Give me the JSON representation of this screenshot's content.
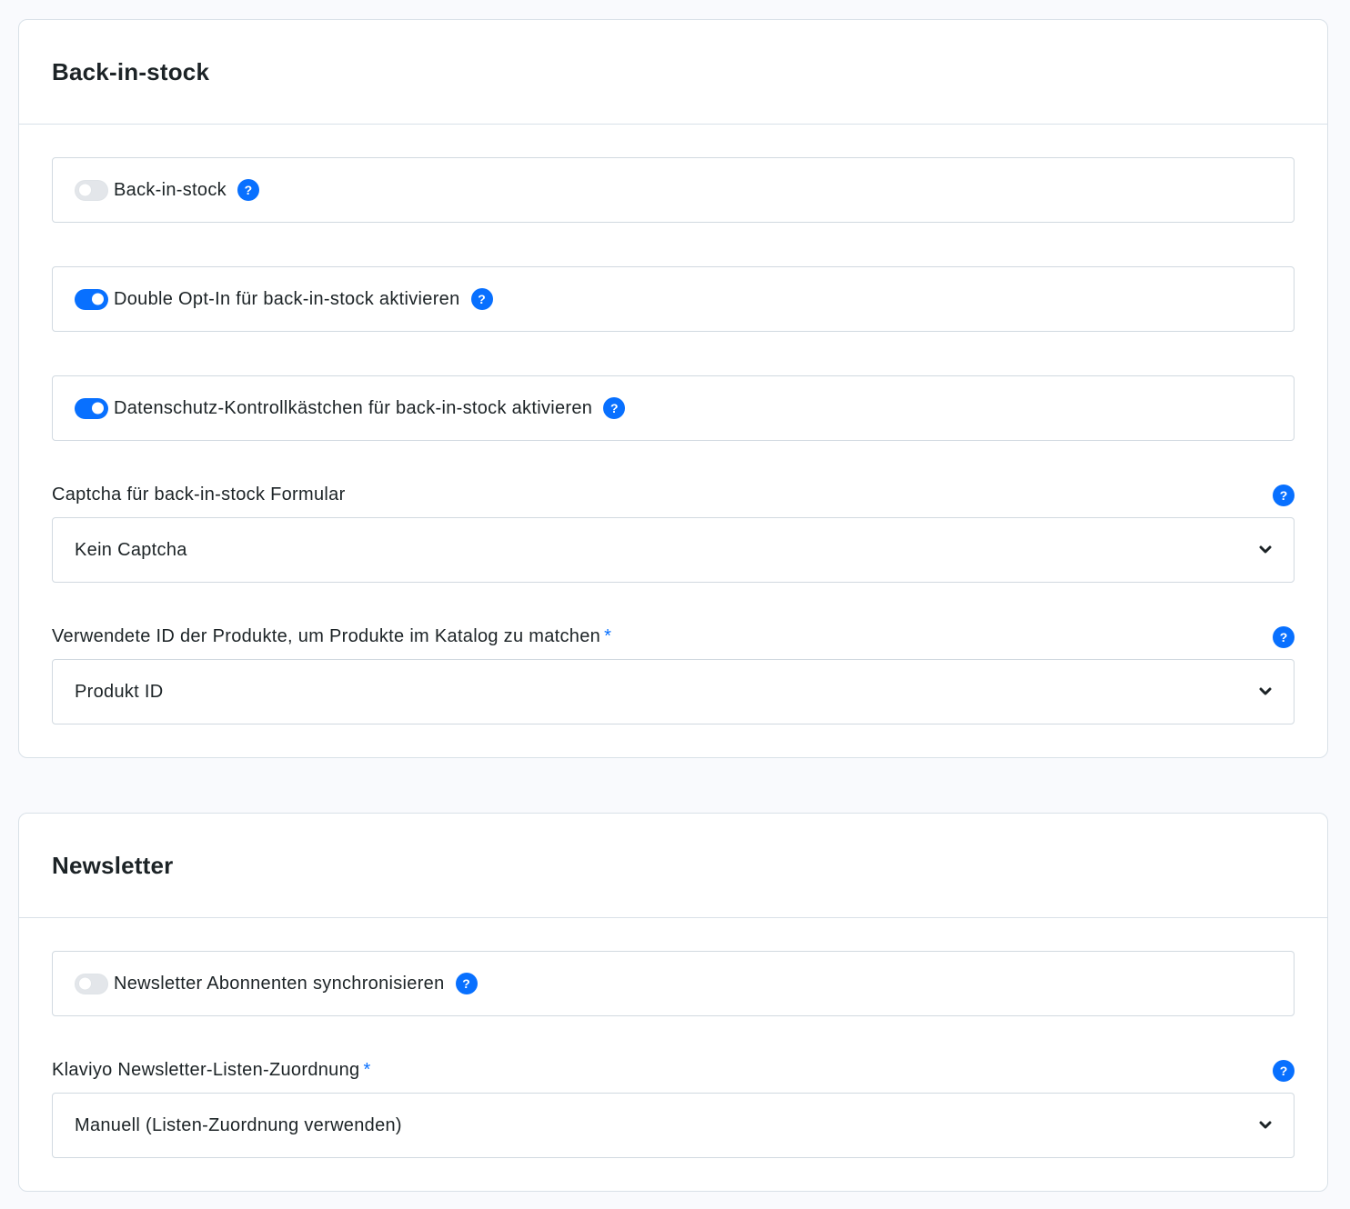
{
  "back_in_stock": {
    "title": "Back-in-stock",
    "toggle_back_in_stock": {
      "label": "Back-in-stock",
      "enabled": false
    },
    "toggle_double_opt_in": {
      "label": "Double Opt-In für back-in-stock aktivieren",
      "enabled": true
    },
    "toggle_privacy_checkbox": {
      "label": "Datenschutz-Kontrollkästchen für back-in-stock aktivieren",
      "enabled": true
    },
    "captcha": {
      "label": "Captcha für back-in-stock Formular",
      "value": "Kein Captcha"
    },
    "product_id": {
      "label": "Verwendete ID der Produkte, um Produkte im Katalog zu matchen",
      "required_mark": "*",
      "value": "Produkt ID"
    }
  },
  "newsletter": {
    "title": "Newsletter",
    "toggle_sync_subscribers": {
      "label": "Newsletter Abonnenten synchronisieren",
      "enabled": false
    },
    "list_mapping": {
      "label": "Klaviyo Newsletter-Listen-Zuordnung",
      "required_mark": "*",
      "value": "Manuell (Listen-Zuordnung verwenden)"
    }
  },
  "icons": {
    "help": "?",
    "help_icon_name": "help-question-icon",
    "chevron_icon_name": "chevron-down-icon"
  },
  "colors": {
    "accent": "#0870ff",
    "toggle_off": "#e3e6ea",
    "border": "#d1d9e0",
    "background": "#f9fafd"
  }
}
